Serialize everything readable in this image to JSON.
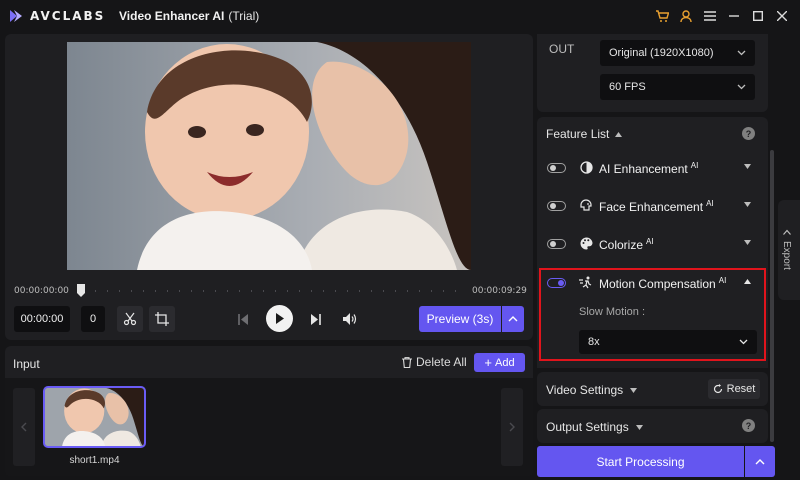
{
  "app": {
    "brand": "AVCLABS",
    "title": "Video Enhancer AI",
    "edition": "(Trial)"
  },
  "colors": {
    "accent": "#6456f0",
    "highlight": "#e0141c",
    "cart_icon": "#e8a030"
  },
  "titlebar_icons": [
    "cart-icon",
    "user-icon",
    "menu-icon",
    "minimize-icon",
    "maximize-icon",
    "close-icon"
  ],
  "player": {
    "time_start": "00:00:00:00",
    "time_end": "00:00:09:29",
    "current_time": "00:00:00",
    "frame": "0",
    "preview_label": "Preview (3s)"
  },
  "input": {
    "title": "Input",
    "delete_all": "Delete All",
    "add": "Add",
    "files": [
      {
        "name": "short1.mp4"
      }
    ]
  },
  "output": {
    "label": "OUT",
    "resolution": "Original (1920X1080)",
    "fps": "60 FPS"
  },
  "feature_list": {
    "title": "Feature List",
    "help": "?",
    "features": [
      {
        "label": "AI Enhancement",
        "badge": "AI",
        "enabled": false,
        "expanded": false
      },
      {
        "label": "Face Enhancement",
        "badge": "AI",
        "enabled": false,
        "expanded": false
      },
      {
        "label": "Colorize",
        "badge": "AI",
        "enabled": false,
        "expanded": false
      },
      {
        "label": "Motion Compensation",
        "badge": "AI",
        "enabled": true,
        "expanded": true
      }
    ],
    "slow_motion_label": "Slow Motion :",
    "slow_motion_value": "8x"
  },
  "video_settings": {
    "title": "Video Settings",
    "reset": "Reset"
  },
  "output_settings": {
    "title": "Output Settings",
    "help": "?"
  },
  "start_processing": "Start Processing",
  "export_tab": "Export"
}
